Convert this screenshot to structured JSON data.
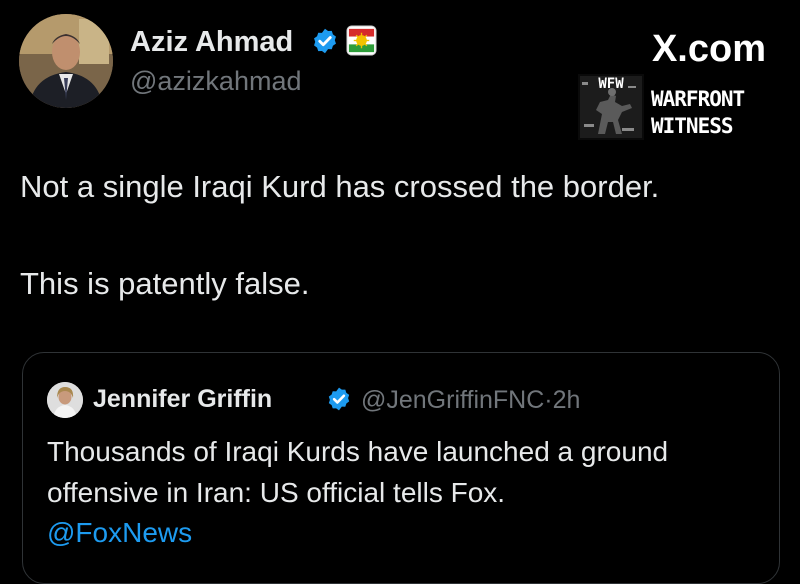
{
  "header": {
    "site_label": "X.com"
  },
  "watermark": {
    "emblem_text": "WFW",
    "line1": "WARFRONT",
    "line2": "WITNESS"
  },
  "tweet": {
    "author_name": "Aziz Ahmad",
    "author_handle": "@azizkahmad",
    "verified_icon": "verified-badge-icon",
    "flag_icon": "kurdistan-flag-icon",
    "lines": [
      "Not a single Iraqi Kurd has crossed the border.",
      "This is patently false."
    ]
  },
  "quoted_tweet": {
    "author_name": "Jennifer Griffin",
    "author_handle": "@JenGriffinFNC",
    "time": "2h",
    "text_lines": [
      "Thousands of Iraqi Kurds have launched a ground",
      "offensive in Iran: US official tells Fox."
    ],
    "mention": "@FoxNews"
  },
  "colors": {
    "background": "#000000",
    "text": "#e7e9ea",
    "muted": "#71767b",
    "link": "#1d9bf0",
    "verified": "#1d9bf0",
    "border": "#2f3336"
  }
}
